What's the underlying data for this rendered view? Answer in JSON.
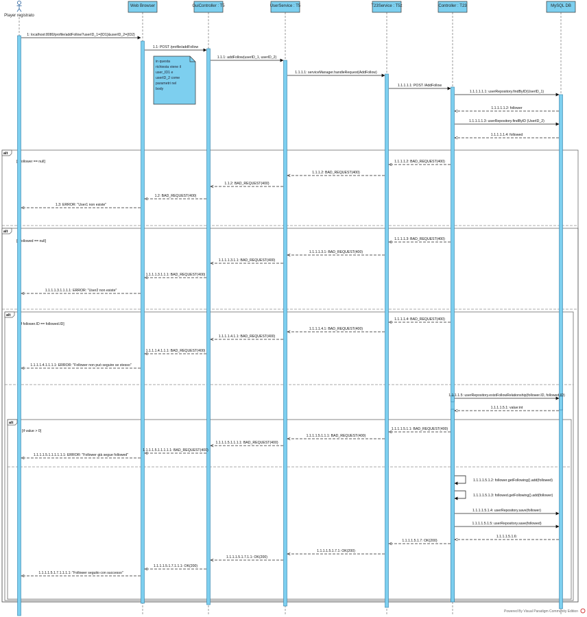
{
  "actor": {
    "name": "Player registrato"
  },
  "lifelines": [
    {
      "id": "wb",
      "label": "Web Browser"
    },
    {
      "id": "gc",
      "label": "GuiController : T5"
    },
    {
      "id": "us",
      "label": "UserService : T5"
    },
    {
      "id": "t23",
      "label": "T23Service : T5z"
    },
    {
      "id": "ctl",
      "label": "Controller : T23"
    },
    {
      "id": "db",
      "label": "MySQL DB"
    }
  ],
  "note": {
    "lines": [
      "in questa",
      "richiesta viene il",
      "user_ID1 e",
      "userID_2 come",
      "parametri nel",
      "body"
    ]
  },
  "fragments": [
    {
      "label": "alt",
      "guard": "[if follower == null]"
    },
    {
      "label": "alt",
      "guard": "[if followed == null]"
    },
    {
      "label": "alt",
      "guard": "[if follower.ID == followed.ID]"
    },
    {
      "label": "alt",
      "guard": "[if value > 0]"
    }
  ],
  "messages": [
    "1: localhost:8080/profile/addFollow?userID_1={ID1}&userID_2={ID2}",
    "1.1: POST /profile/addFollow",
    "1.1.1: addFollow(userID_1, userID_2)",
    "1.1.1.1: serviceManager.handleRequest(AddFollow)",
    "1.1.1.1.1: POST /AddFollow",
    "1.1.1.1.1.1: userRepository.findByID(UserID_1)",
    "1.1.1.1.1.2: follower",
    "1.1.1.1.1.3: userRepository.findByID (UserID_2)",
    "1.1.1.1.1.4: followed",
    "1.1.1.1.2: BAD_REQUEST(400)",
    "1.1.1.2: BAD_REQUEST(400)",
    "1.1.2: BAD_REQUEST(400)",
    "1.2: BAD_REQUEST(400)",
    "1.3: ERROR: \"User1 non esiste\"",
    "1.1.1.1.3: BAD_REQUEST(400)",
    "1.1.1.1.3.1: BAD_REQUEST(400)",
    "1.1.1.1.3.1.1: BAD_REQUEST(400)",
    "1.1.1.1.3.1.1.1: BAD_REQUEST(400)",
    "1.1.1.1.3.1.1.1.1: ERROR: \"User2 non esiste\"",
    "1.1.1.1.4: BAD_REQUEST(400)",
    "1.1.1.1.4.1: BAD_REQUEST(400)",
    "1.1.1.1.4.1.1: BAD_REQUEST(400)",
    "1.1.1.1.4.1.1.1: BAD_REQUEST(400)",
    "1.1.1.1.4.1.1.1.1: ERROR: \"Follower non può seguire se stesso\"",
    "1.1.1.1.5: userRepository.existFollowRelationship(follower.ID, followed.ID)",
    "1.1.1.1.5.1: value:int",
    "1.1.1.1.5.1.1: BAD_REQUEST(400)",
    "1.1.1.1.5.1.1.1: BAD_REQUEST(400)",
    "1.1.1.1.5.1.1.1.1: BAD_REQUEST(400)",
    "1.1.1.1.5.1.1.1.1.1: BAD_REQUEST(400)",
    "1.1.1.1.5.1.1.1.1.1.1: ERROR: \"Follower già segue followed\"",
    "1.1.1.1.5.1.2: follower.getFollowing().add(followed)",
    "1.1.1.1.5.1.3: followed.getFollowing().add(follower)",
    "1.1.1.1.5.1.4: userRepository.save(follower)",
    "1.1.1.1.5.1.5: userRepository.save(followed)",
    "1.1.1.1.5.1.6:",
    "1.1.1.1.5.1.7: OK(200)",
    "1.1.1.1.5.1.7.1: OK(200)",
    "1.1.1.1.5.1.7.1.1: OK(200)",
    "1.1.1.1.5.1.7.1.1.1: OK(200)",
    "1.1.1.1.5.1.7.1.1.1.1: \"Follower seguito con successo\""
  ],
  "footer": "Powered By  Visual Paradigm Community Edition",
  "colors": {
    "lifeline_header": "#7dcfef",
    "activation": "#7dcfef",
    "note_fill": "#7dcfef",
    "line": "#222222",
    "fragment_border": "#555555",
    "footer_logo": "#d23c3c"
  }
}
